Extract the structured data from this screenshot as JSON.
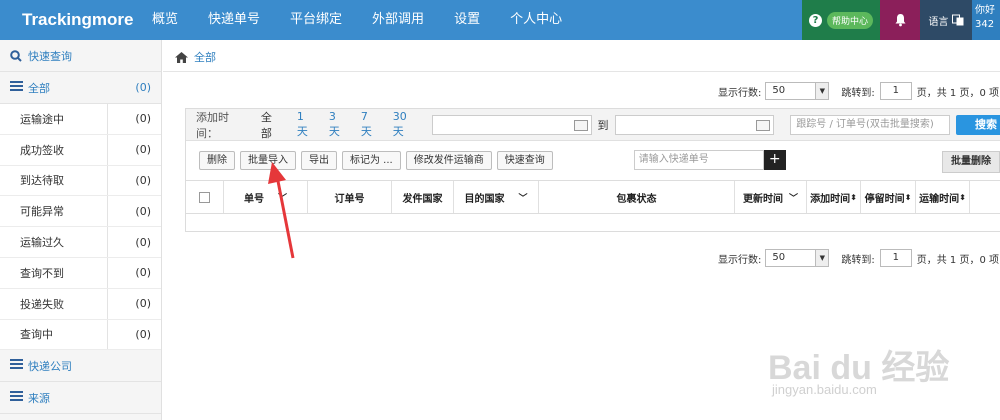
{
  "topbar": {
    "brand": "Trackingmore",
    "nav": [
      "概览",
      "快递单号",
      "平台绑定",
      "外部调用",
      "设置",
      "个人中心"
    ],
    "help_label": "帮助中心",
    "lang_label": "语言",
    "user_line1": "你好",
    "user_line2": "342"
  },
  "sidebar": {
    "quick_query": "快速查询",
    "all_label": "全部",
    "all_count": "(0)",
    "items": [
      {
        "label": "运输途中",
        "count": "(0)"
      },
      {
        "label": "成功签收",
        "count": "(0)"
      },
      {
        "label": "到达待取",
        "count": "(0)"
      },
      {
        "label": "可能异常",
        "count": "(0)"
      },
      {
        "label": "运输过久",
        "count": "(0)"
      },
      {
        "label": "查询不到",
        "count": "(0)"
      },
      {
        "label": "投递失败",
        "count": "(0)"
      },
      {
        "label": "查询中",
        "count": "(0)"
      }
    ],
    "courier": "快递公司",
    "source": "来源"
  },
  "breadcrumb": "全部",
  "pager": {
    "rows_label": "显示行数:",
    "rows_value": "50",
    "jump_label": "跳转到:",
    "page_value": "1",
    "summary": "页，共 1 页，0 项"
  },
  "filter": {
    "label": "添加时间：",
    "options": [
      "全部",
      "1天",
      "3天",
      "7天",
      "30天"
    ],
    "to": "到",
    "search_placeholder": "跟踪号 / 订单号(双击批量搜索)",
    "search_button": "搜索"
  },
  "actions": {
    "delete": "删除",
    "bulk_import": "批量导入",
    "export": "导出",
    "mark_as": "标记为 ...",
    "change_carrier": "修改发件运输商",
    "quick_query": "快速查询",
    "quick_placeholder": "请输入快递单号",
    "plus": "+",
    "bulk_delete": "批量删除"
  },
  "table": {
    "headers": [
      "单号",
      "订单号",
      "发件国家",
      "目的国家",
      "包裹状态",
      "更新时间",
      "添加时间",
      "停留时间",
      "运输时间"
    ]
  },
  "watermark": {
    "main": "Bai du 经验",
    "sub": "jingyan.baidu.com"
  },
  "colors": {
    "topbar": "#3b8ccd",
    "help_bg": "#1f7d4a",
    "bell_bg": "#8b1f5a",
    "lang_bg": "#2e4a66",
    "accent": "#2f7fbf",
    "search_button": "#2a95e0",
    "arrow": "#e5373a"
  }
}
